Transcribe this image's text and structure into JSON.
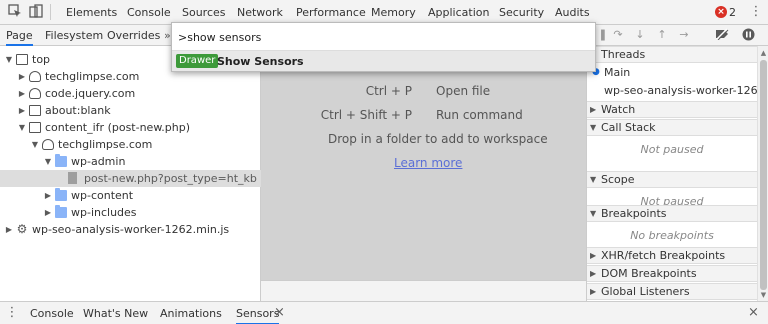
{
  "toolbar": {
    "icons": [
      "inspect-icon",
      "device-toggle-icon"
    ],
    "tabs": [
      "Elements",
      "Console",
      "Sources",
      "Network",
      "Performance",
      "Memory",
      "Application",
      "Security",
      "Audits"
    ],
    "error_count": "2",
    "error_symbol": "×"
  },
  "left": {
    "subtabs": [
      "Page",
      "Filesystem",
      "Overrides"
    ],
    "tree": [
      {
        "label": "top",
        "arrow": "▼",
        "icon": "frame"
      },
      {
        "label": "techglimpse.com",
        "arrow": "▶",
        "icon": "cloud"
      },
      {
        "label": "code.jquery.com",
        "arrow": "▶",
        "icon": "cloud"
      },
      {
        "label": "about:blank",
        "arrow": "▶",
        "icon": "frame"
      },
      {
        "label": "content_ifr (post-new.php)",
        "arrow": "▼",
        "icon": "frame"
      },
      {
        "label": "techglimpse.com",
        "arrow": "▼",
        "icon": "cloud"
      },
      {
        "label": "wp-admin",
        "arrow": "▼",
        "icon": "folder"
      },
      {
        "label": "post-new.php?post_type=ht_kb",
        "arrow": "",
        "icon": "file"
      },
      {
        "label": "wp-content",
        "arrow": "▶",
        "icon": "folder"
      },
      {
        "label": "wp-includes",
        "arrow": "▶",
        "icon": "folder"
      },
      {
        "label": "wp-seo-analysis-worker-1262.min.js",
        "arrow": "▶",
        "icon": "gear"
      }
    ]
  },
  "palette": {
    "query": ">show sensors",
    "result_badge": "Drawer",
    "result_label": "Show Sensors"
  },
  "middle": {
    "hints": [
      {
        "keys": "Ctrl + P",
        "action": "Open file"
      },
      {
        "keys": "Ctrl + Shift + P",
        "action": "Run command"
      }
    ],
    "drop_hint": "Drop in a folder to add to workspace",
    "learn_more": "Learn more"
  },
  "right": {
    "threads_header": "Threads",
    "threads": [
      "Main",
      "wp-seo-analysis-worker-1262..."
    ],
    "sections": [
      {
        "title": "Watch",
        "body": ""
      },
      {
        "title": "Call Stack",
        "body": "Not paused"
      },
      {
        "title": "Scope",
        "body": "Not paused"
      },
      {
        "title": "Breakpoints",
        "body": "No breakpoints"
      },
      {
        "title": "XHR/fetch Breakpoints",
        "body": ""
      },
      {
        "title": "DOM Breakpoints",
        "body": ""
      },
      {
        "title": "Global Listeners",
        "body": ""
      }
    ]
  },
  "drawer": {
    "tabs": [
      "Console",
      "What's New",
      "Animations",
      "Sensors"
    ],
    "active_tab": "Sensors",
    "close_symbol": "×"
  },
  "colors": {
    "accent": "#1a73e8",
    "badge": "#3d9a3a",
    "error": "#d93025",
    "link": "#5b6fd6"
  }
}
